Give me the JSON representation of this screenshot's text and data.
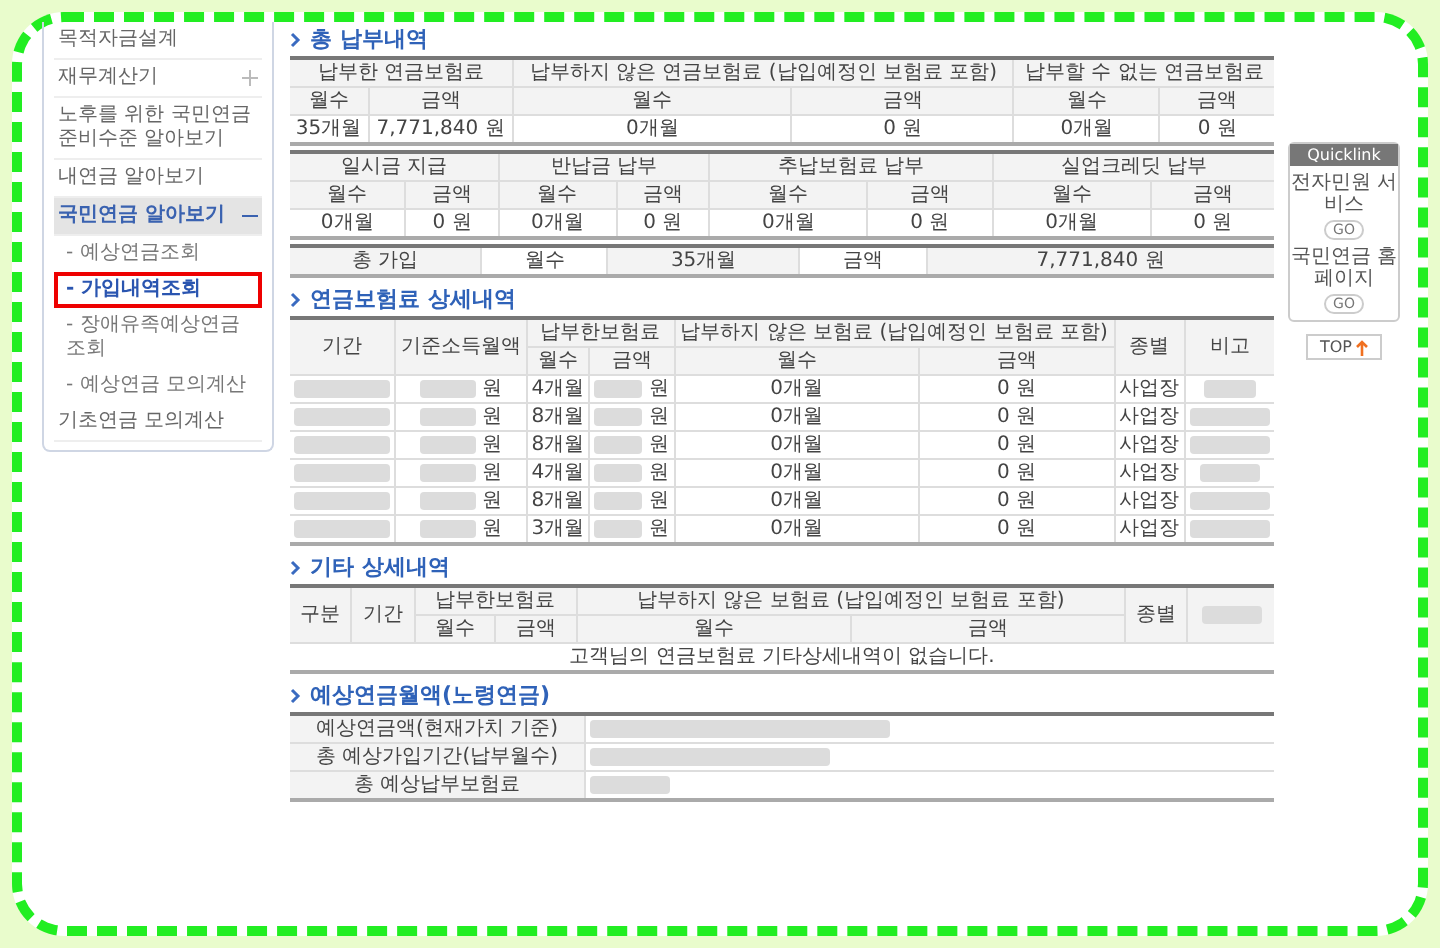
{
  "sidebar": {
    "items": [
      {
        "label": "목적자금설계",
        "kind": "link"
      },
      {
        "label": "재무계산기",
        "kind": "folder",
        "expanded": false
      },
      {
        "label": "노후를 위한 국민연금 준비수준 알아보기",
        "kind": "link"
      },
      {
        "label": "내연금 알아보기",
        "kind": "link"
      },
      {
        "label": "국민연금 알아보기",
        "kind": "folder",
        "expanded": true,
        "children": [
          {
            "label": "- 예상연금조회",
            "selected": false
          },
          {
            "label": "- 가입내역조회",
            "selected": true
          },
          {
            "label": "- 장애유족예상연금조회",
            "selected": false
          },
          {
            "label": "- 예상연금 모의계산",
            "selected": false
          }
        ]
      },
      {
        "label": "기초연금 모의계산",
        "kind": "link"
      }
    ]
  },
  "total_payment": {
    "title": "총 납부내역",
    "table1": {
      "groups": [
        "납부한 연금보험료",
        "납부하지 않은 연금보험료 (납입예정인 보험료 포함)",
        "납부할 수 없는 연금보험료"
      ],
      "subcolumns": [
        "월수",
        "금액",
        "월수",
        "금액",
        "월수",
        "금액"
      ],
      "row": [
        "35개월",
        "7,771,840 원",
        "0개월",
        "0 원",
        "0개월",
        "0 원"
      ]
    },
    "table2": {
      "groups": [
        "일시금 지급",
        "반납금 납부",
        "추납보험료 납부",
        "실업크레딧 납부"
      ],
      "subcolumns": [
        "월수",
        "금액",
        "월수",
        "금액",
        "월수",
        "금액",
        "월수",
        "금액"
      ],
      "row": [
        "0개월",
        "0 원",
        "0개월",
        "0 원",
        "0개월",
        "0 원",
        "0개월",
        "0 원"
      ]
    },
    "summary": [
      "총 가입",
      "월수",
      "35개월",
      "금액",
      "7,771,840 원"
    ]
  },
  "premium_detail": {
    "title": "연금보험료 상세내역",
    "columns": [
      "기간",
      "기준소득월액",
      "납부한보험료",
      "납부하지 않은 보험료 (납입예정인 보험료 포함)",
      "종별",
      "비고"
    ],
    "subcolumns": [
      "월수",
      "금액",
      "월수",
      "금액"
    ],
    "rows": [
      {
        "income_unit": "원",
        "months": "4개월",
        "paid_unit": "원",
        "unpaid_months": "0개월",
        "unpaid_amount": "0 원",
        "type": "사업장"
      },
      {
        "income_unit": "원",
        "months": "8개월",
        "paid_unit": "원",
        "unpaid_months": "0개월",
        "unpaid_amount": "0 원",
        "type": "사업장"
      },
      {
        "income_unit": "원",
        "months": "8개월",
        "paid_unit": "원",
        "unpaid_months": "0개월",
        "unpaid_amount": "0 원",
        "type": "사업장"
      },
      {
        "income_unit": "원",
        "months": "4개월",
        "paid_unit": "원",
        "unpaid_months": "0개월",
        "unpaid_amount": "0 원",
        "type": "사업장"
      },
      {
        "income_unit": "원",
        "months": "8개월",
        "paid_unit": "원",
        "unpaid_months": "0개월",
        "unpaid_amount": "0 원",
        "type": "사업장"
      },
      {
        "income_unit": "원",
        "months": "3개월",
        "paid_unit": "원",
        "unpaid_months": "0개월",
        "unpaid_amount": "0 원",
        "type": "사업장"
      }
    ]
  },
  "other_detail": {
    "title": "기타 상세내역",
    "columns": [
      "구분",
      "기간",
      "납부한보험료",
      "납부하지 않은 보험료 (납입예정인 보험료 포함)",
      "종별"
    ],
    "subcolumns": [
      "월수",
      "금액",
      "월수",
      "금액"
    ],
    "empty_message": "고객님의 연금보험료 기타상세내역이 없습니다."
  },
  "expected_pension": {
    "title": "예상연금월액(노령연금)",
    "rows": [
      "예상연금액(현재가치 기준)",
      "총 예상가입기간(납부월수)",
      "총 예상납부보험료"
    ]
  },
  "quicklink": {
    "title": "Quicklink",
    "links": [
      {
        "label": "전자민원 서비스",
        "go": "GO"
      },
      {
        "label": "국민연금 홈페이지",
        "go": "GO"
      }
    ],
    "top": "TOP"
  }
}
